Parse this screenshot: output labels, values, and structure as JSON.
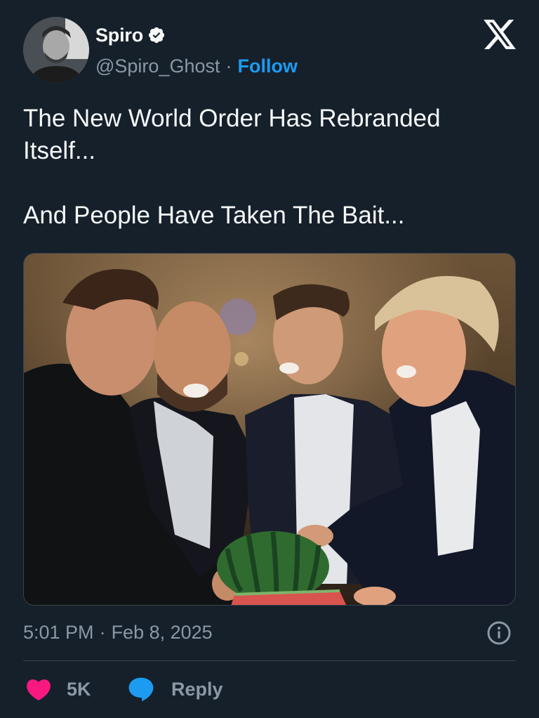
{
  "author": {
    "display_name": "Spiro",
    "handle": "@Spiro_Ghost",
    "verified": true,
    "separator": "·",
    "follow_label": "Follow"
  },
  "tweet": {
    "text": "The New World Order Has Rebranded Itself...\n\nAnd People Have Taken The Bait...",
    "time": "5:01 PM",
    "date_separator": "·",
    "date": "Feb 8, 2025"
  },
  "actions": {
    "like_count": "5K",
    "reply_label": "Reply"
  },
  "icons": {
    "platform": "x-logo-icon",
    "verified": "verified-badge-icon",
    "info": "info-icon",
    "like": "heart-icon",
    "reply": "speech-bubble-icon"
  },
  "colors": {
    "background": "#15202b",
    "text_primary": "#f7f9f9",
    "text_secondary": "#8b98a5",
    "accent": "#1d9bf0",
    "like": "#f91880",
    "divider": "#38444d"
  }
}
